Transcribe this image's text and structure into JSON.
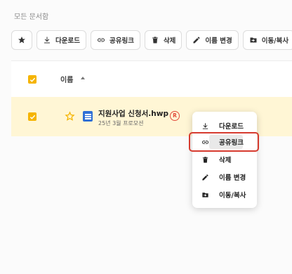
{
  "breadcrumb": "모든 문서함",
  "toolbar": {
    "download": "다운로드",
    "share_link": "공유링크",
    "delete": "삭제",
    "rename": "이름 변경",
    "move_copy": "이동/복사"
  },
  "table": {
    "header_name": "이름"
  },
  "file": {
    "name": "지원사업 신청서.hwp",
    "date": "25년 3월 프로모션",
    "badge": "R"
  },
  "context_menu": {
    "items": [
      {
        "label": "다운로드",
        "icon": "download-icon"
      },
      {
        "label": "공유링크",
        "icon": "link-icon"
      },
      {
        "label": "삭제",
        "icon": "trash-icon"
      },
      {
        "label": "이름 변경",
        "icon": "pencil-icon"
      },
      {
        "label": "이동/복사",
        "icon": "move-icon"
      }
    ],
    "hovered": "공유링크"
  },
  "colors": {
    "accent": "#f5b400",
    "selected_row": "#fff6d5",
    "highlight": "#d63b2f"
  }
}
